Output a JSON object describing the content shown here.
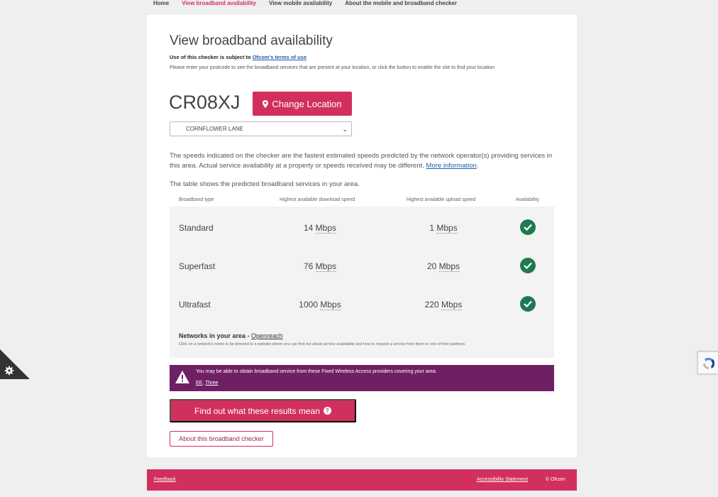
{
  "topnav": [
    {
      "label": "Home",
      "active": false
    },
    {
      "label": "View broadband availability",
      "active": true
    },
    {
      "label": "View mobile availability",
      "active": false
    },
    {
      "label": "About the mobile and broadband checker",
      "active": false
    }
  ],
  "page": {
    "title": "View broadband availability",
    "terms_prefix": "Use of this checker is subject to ",
    "terms_link": "Ofcom's terms of use",
    "intro": "Please enter your postcode to see the broadband services that are present at your location, or click the button to enable the site to find your location"
  },
  "location": {
    "postcode": "CR08XJ",
    "change_label": "Change Location",
    "address_selected": "CORNFLOWER LANE"
  },
  "info": {
    "speeds_text": "The speeds indicated on the checker are the fastest estimated speeds predicted by the network operator(s) providing services in this area. Actual service availability at a property or speeds received may be different.",
    "more_info_link": "More information",
    "table_intro": "The table shows the predicted broadband services in your area."
  },
  "table": {
    "headers": [
      "Broadband type",
      "Highest available download speed",
      "Highest available upload speed",
      "Availability"
    ],
    "rows": [
      {
        "type": "Standard",
        "download": "14",
        "upload": "1",
        "unit": "Mbps",
        "available": true
      },
      {
        "type": "Superfast",
        "download": "76",
        "upload": "20",
        "unit": "Mbps",
        "available": true
      },
      {
        "type": "Ultrafast",
        "download": "1000",
        "upload": "220",
        "unit": "Mbps",
        "available": true
      }
    ],
    "networks_label": "Networks in your area - ",
    "networks_link": "Openreach",
    "networks_note": "Click on a network's name to be directed to a website where you can find out about service availability and how to request a service from them or one of their partners."
  },
  "fwa": {
    "message": "You may be able to obtain broadband service from these Fixed Wireless Access providers covering your area.",
    "providers": [
      "EE",
      "Three"
    ],
    "bg_color": "#6f2064"
  },
  "actions": {
    "results_label": "Find out what these results mean",
    "about_label": "About this broadband checker"
  },
  "footer": {
    "feedback": "Feedback",
    "accessibility": "Accessibility Statement",
    "copyright": "© Ofcom"
  },
  "colors": {
    "accent": "#d1305f",
    "check": "#1d7a50"
  },
  "icons": {
    "location": "map-marker-icon",
    "check": "check-circle-icon",
    "warning": "warning-triangle-icon",
    "question": "question-circle-icon",
    "settings": "gear-icon",
    "recaptcha": "recaptcha-icon"
  }
}
